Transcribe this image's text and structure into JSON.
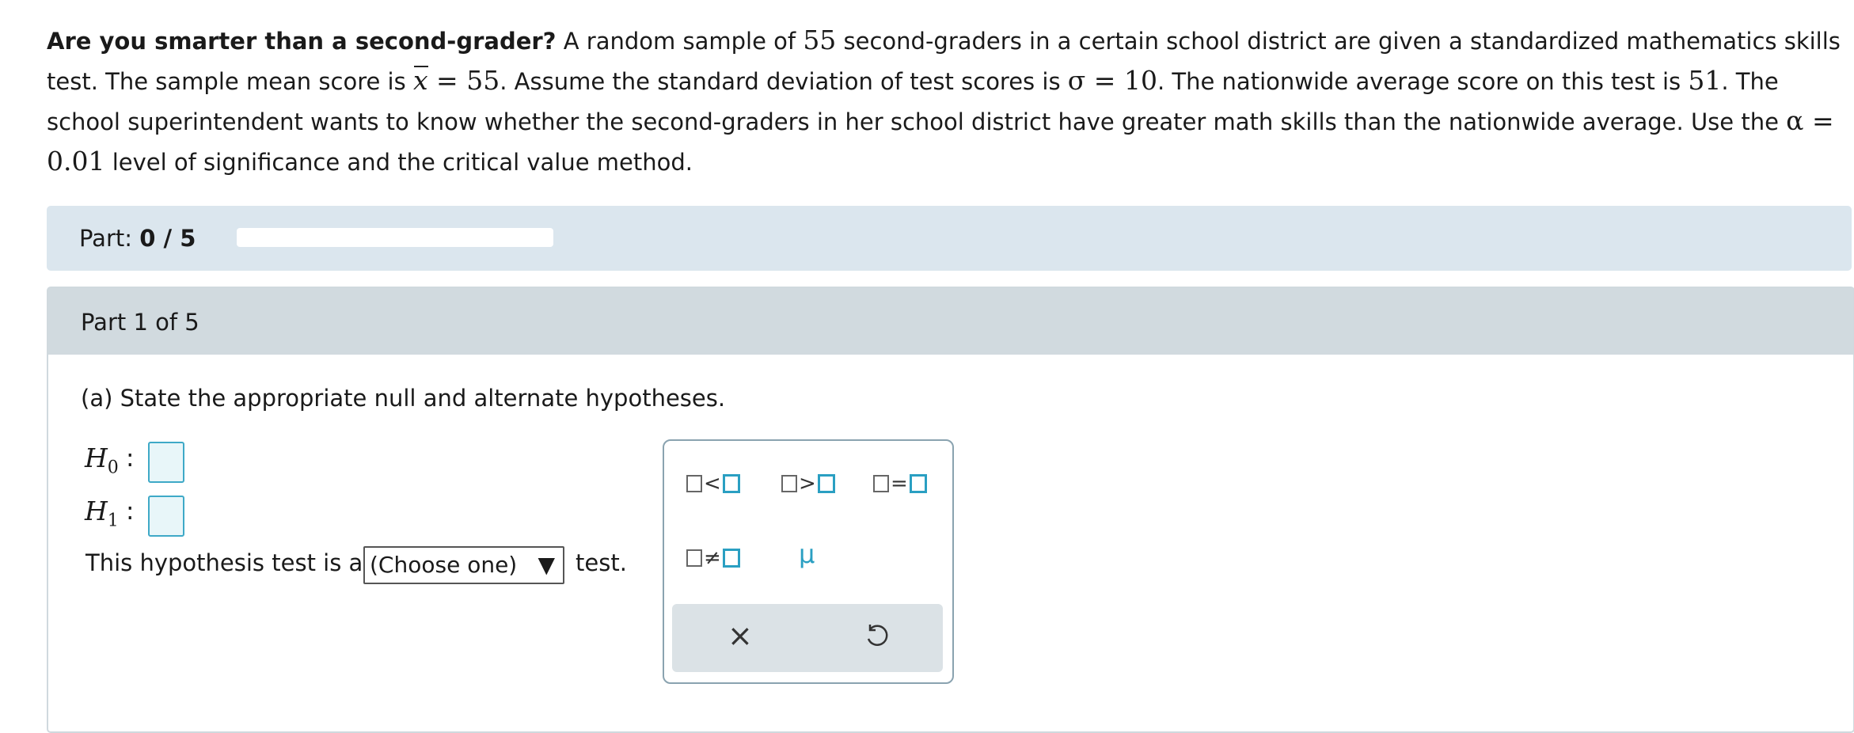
{
  "problem": {
    "bold_lead": "Are you smarter than a second-grader?",
    "s1_a": " A random sample of ",
    "n": "55",
    "s1_b": " second-graders in a certain school district are given a standardized mathematics skills test. The sample mean score is ",
    "xbar_sym": "x",
    "eq1": " = ",
    "xbar_val": "55",
    "s2_a": ". Assume the standard deviation of test scores is ",
    "sigma_sym": "σ",
    "eq2": " = ",
    "sigma_val": "10",
    "s2_b": ". The nationwide average score on this test is ",
    "nat_avg": "51",
    "s2_c": ". The school superintendent wants to know whether the second-graders in her school district have greater math skills than the nationwide average. Use the ",
    "alpha_sym": "α",
    "eq3": " = ",
    "alpha_val": "0.01",
    "s3": " level of significance and the critical value method."
  },
  "progress": {
    "label": "Part: ",
    "value": "0 / 5",
    "fraction": 0
  },
  "part": {
    "title": "Part 1 of 5",
    "question": "(a) State the appropriate null and alternate hypotheses.",
    "h0_letter": "H",
    "h0_sub": "0",
    "h1_letter": "H",
    "h1_sub": "1",
    "colon": ":",
    "test_before": "This hypothesis test is a",
    "select_value": "(Choose one)",
    "select_arrow": "▼",
    "test_after": "test."
  },
  "palette": {
    "less": "<",
    "greater": ">",
    "equal": "=",
    "not_equal": "≠",
    "mu": "μ",
    "clear": "×"
  },
  "colors": {
    "accent": "#2a9fc2",
    "part_bar_bg": "#dbe6ee",
    "part_header_bg": "#d1dadf"
  },
  "icons": {
    "clear": "close-icon",
    "undo": "undo-icon"
  }
}
